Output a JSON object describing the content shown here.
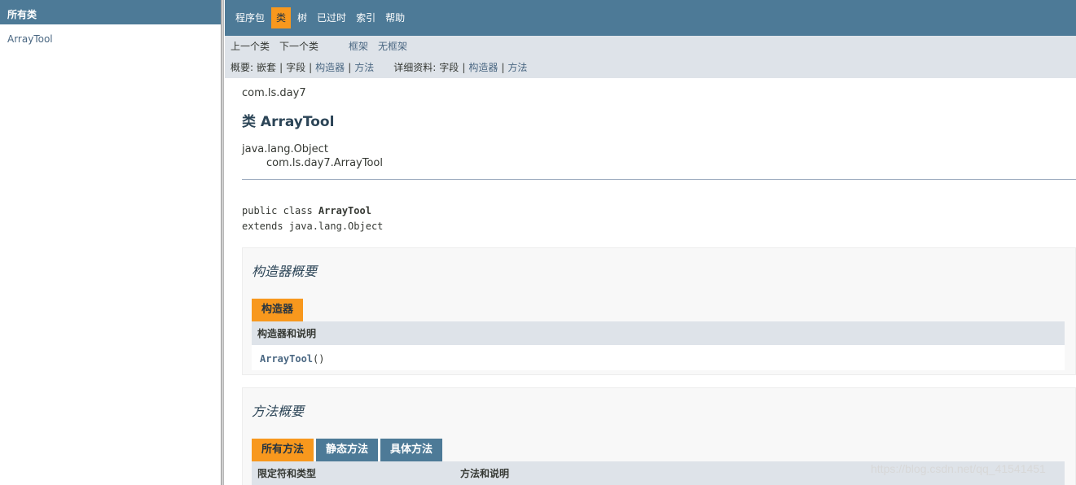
{
  "left_panel": {
    "header": "所有类",
    "classes": [
      "ArrayTool"
    ]
  },
  "nav": {
    "items": [
      "程序包",
      "类",
      "树",
      "已过时",
      "索引",
      "帮助"
    ],
    "active": "类"
  },
  "subnav": {
    "prev_class": "上一个类",
    "next_class": "下一个类",
    "frames": "框架",
    "no_frames": "无框架",
    "summary_label": "概要:",
    "summary_nested": "嵌套",
    "summary_field": "字段",
    "summary_constructor": "构造器",
    "summary_method": "方法",
    "detail_label": "详细资料:",
    "detail_field": "字段",
    "detail_constructor": "构造器",
    "detail_method": "方法",
    "separator": "|"
  },
  "content": {
    "package": "com.ls.day7",
    "title": "类 ArrayTool",
    "inheritance": [
      "java.lang.Object",
      "com.ls.day7.ArrayTool"
    ],
    "declaration": {
      "line1_prefix": "public class ",
      "class_name": "ArrayTool",
      "line2": "extends java.lang.Object"
    },
    "constructor_summary": {
      "title": "构造器概要",
      "tab": "构造器",
      "header": "构造器和说明",
      "rows": [
        {
          "name": "ArrayTool",
          "params": "()"
        }
      ]
    },
    "method_summary": {
      "title": "方法概要",
      "tabs": [
        "所有方法",
        "静态方法",
        "具体方法"
      ],
      "active_tab": "所有方法",
      "header_col1": "限定符和类型",
      "header_col2": "方法和说明"
    }
  },
  "watermark": "https://blog.csdn.net/qq_41541451",
  "colors": {
    "nav_bg": "#4d7a97",
    "active_tab": "#f8981d",
    "subnav_bg": "#dee3e9",
    "link": "#4a6782"
  }
}
